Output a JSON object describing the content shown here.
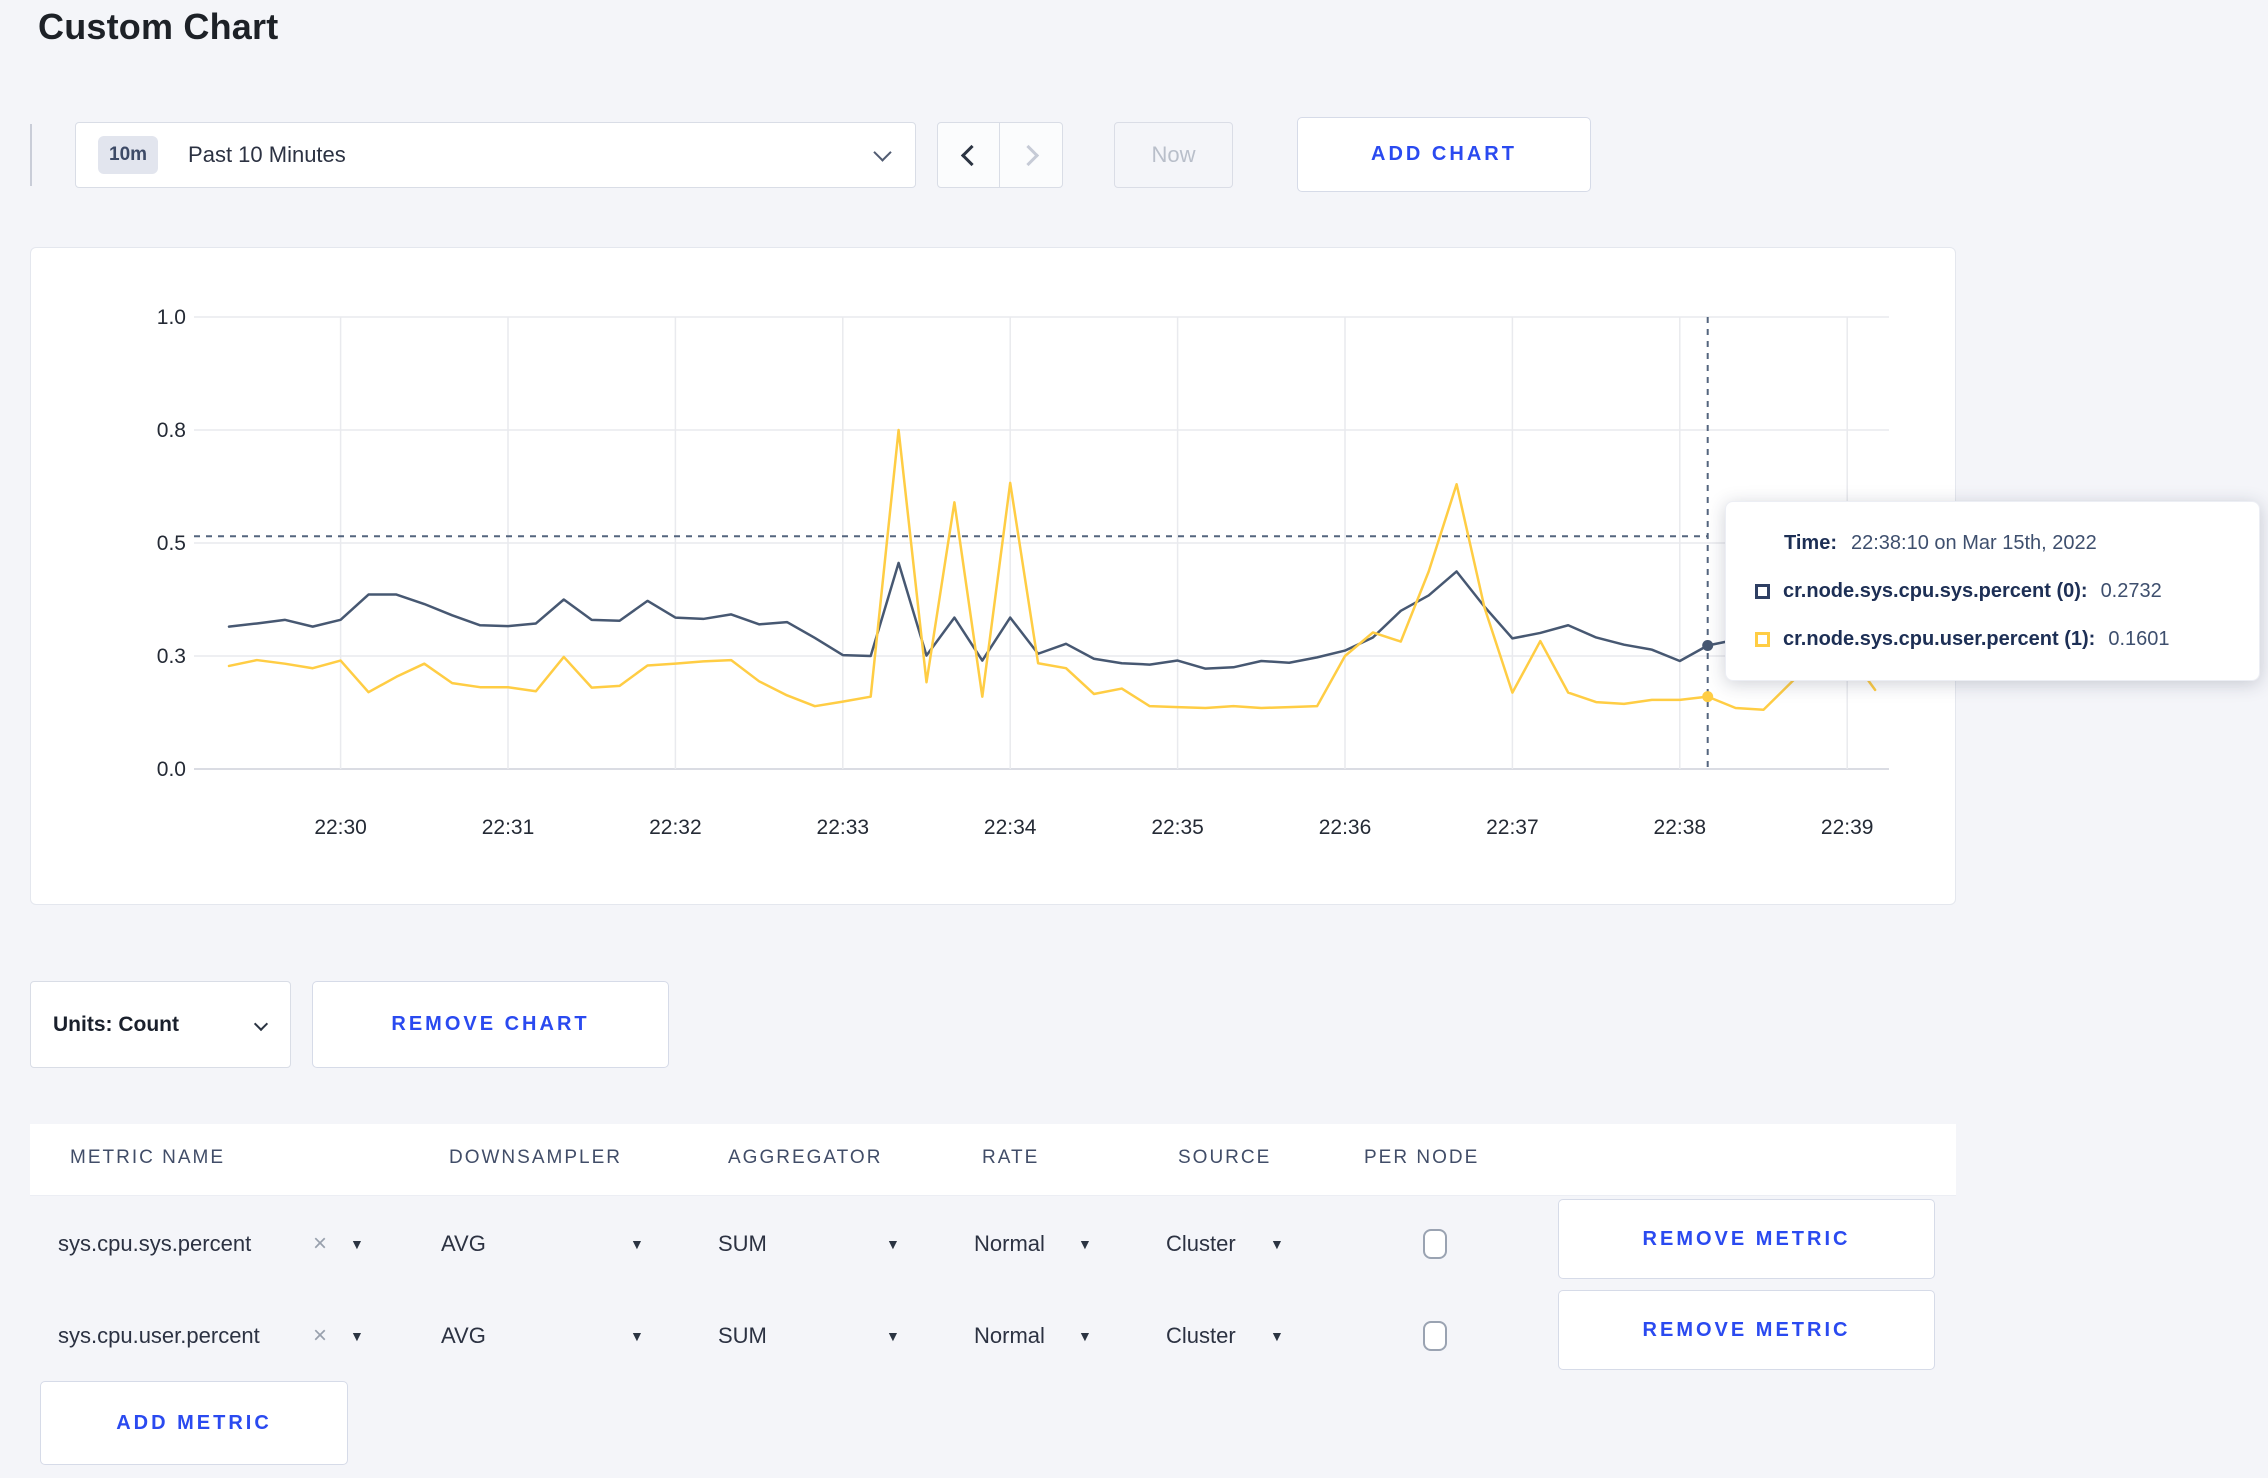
{
  "page": {
    "title": "Custom Chart",
    "accent_blue": "#2a4af0",
    "background": "#f4f5f9"
  },
  "toolbar": {
    "time_badge": "10m",
    "time_label": "Past 10 Minutes",
    "now_label": "Now",
    "add_chart_label": "ADD CHART"
  },
  "chart_controls": {
    "units_label": "Units: Count",
    "remove_chart_label": "REMOVE CHART"
  },
  "chart_data": {
    "type": "line",
    "title": "",
    "xlabel": "",
    "ylabel": "",
    "ylim": [
      0,
      1
    ],
    "grid": true,
    "t_step": 10,
    "start_time": "22:29:20",
    "x_ticks": [
      {
        "label": "22:30",
        "t": 40
      },
      {
        "label": "22:31",
        "t": 100
      },
      {
        "label": "22:32",
        "t": 160
      },
      {
        "label": "22:33",
        "t": 220
      },
      {
        "label": "22:34",
        "t": 280
      },
      {
        "label": "22:35",
        "t": 340
      },
      {
        "label": "22:36",
        "t": 400
      },
      {
        "label": "22:37",
        "t": 460
      },
      {
        "label": "22:38",
        "t": 520
      },
      {
        "label": "22:39",
        "t": 580
      }
    ],
    "y_ticks": [
      {
        "label": "0.0",
        "v": 0
      },
      {
        "label": "0.3",
        "v": 0.25
      },
      {
        "label": "0.5",
        "v": 0.5
      },
      {
        "label": "0.8",
        "v": 0.75
      },
      {
        "label": "1.0",
        "v": 1.0
      }
    ],
    "series": [
      {
        "name": "cr.node.sys.cpu.sys.percent (0)",
        "color": "#475872",
        "values": [
          0.315,
          0.322,
          0.33,
          0.315,
          0.33,
          0.386,
          0.386,
          0.365,
          0.34,
          0.318,
          0.316,
          0.322,
          0.375,
          0.33,
          0.328,
          0.372,
          0.335,
          0.332,
          0.342,
          0.32,
          0.325,
          0.29,
          0.252,
          0.25,
          0.456,
          0.251,
          0.335,
          0.24,
          0.335,
          0.255,
          0.277,
          0.244,
          0.234,
          0.231,
          0.24,
          0.222,
          0.225,
          0.239,
          0.235,
          0.247,
          0.262,
          0.291,
          0.35,
          0.384,
          0.437,
          0.359,
          0.289,
          0.301,
          0.318,
          0.291,
          0.275,
          0.264,
          0.239,
          0.2732,
          0.286,
          0.275,
          0.267,
          0.272,
          0.277,
          0.291
        ]
      },
      {
        "name": "cr.node.sys.cpu.user.percent (1)",
        "color": "#FFCD44",
        "values": [
          0.228,
          0.241,
          0.233,
          0.223,
          0.24,
          0.17,
          0.204,
          0.233,
          0.19,
          0.181,
          0.181,
          0.172,
          0.248,
          0.18,
          0.184,
          0.229,
          0.233,
          0.238,
          0.241,
          0.194,
          0.163,
          0.139,
          0.149,
          0.16,
          0.75,
          0.192,
          0.59,
          0.16,
          0.633,
          0.234,
          0.223,
          0.166,
          0.178,
          0.139,
          0.137,
          0.135,
          0.139,
          0.135,
          0.137,
          0.139,
          0.25,
          0.302,
          0.282,
          0.437,
          0.63,
          0.357,
          0.169,
          0.283,
          0.169,
          0.148,
          0.144,
          0.153,
          0.153,
          0.1601,
          0.135,
          0.131,
          0.192,
          0.253,
          0.26,
          0.175
        ]
      }
    ],
    "crosshair": {
      "t": 530,
      "h_value": 0.515,
      "time": "22:38:10"
    },
    "tooltip": {
      "time_label": "Time:",
      "time_value": "22:38:10 on Mar 15th, 2022",
      "rows": [
        {
          "name": "cr.node.sys.cpu.sys.percent (0):",
          "value": "0.2732",
          "color": "#2e3f63"
        },
        {
          "name": "cr.node.sys.cpu.user.percent (1):",
          "value": "0.1601",
          "color": "#FFCD44"
        }
      ]
    },
    "legend_position": "tooltip-only"
  },
  "metrics_table": {
    "headers": [
      "METRIC NAME",
      "DOWNSAMPLER",
      "AGGREGATOR",
      "RATE",
      "SOURCE",
      "PER NODE"
    ],
    "clear_icon": "×",
    "caret_icon": "▼",
    "rows": [
      {
        "name": "sys.cpu.sys.percent",
        "downsampler": "AVG",
        "aggregator": "SUM",
        "rate": "Normal",
        "source": "Cluster",
        "per_node_checked": false
      },
      {
        "name": "sys.cpu.user.percent",
        "downsampler": "AVG",
        "aggregator": "SUM",
        "rate": "Normal",
        "source": "Cluster",
        "per_node_checked": false
      }
    ],
    "remove_metric_label": "REMOVE METRIC",
    "add_metric_label": "ADD METRIC"
  }
}
